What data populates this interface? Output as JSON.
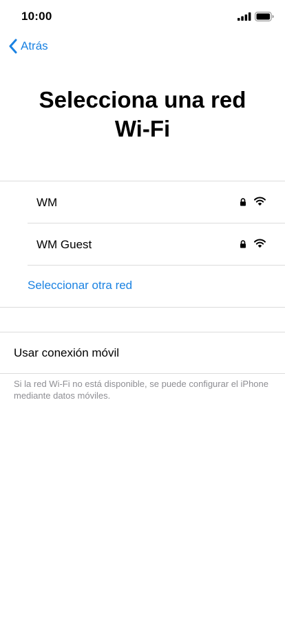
{
  "status_bar": {
    "time": "10:00"
  },
  "nav": {
    "back_label": "Atrás"
  },
  "title": {
    "line1": "Selecciona una red",
    "line2": "Wi-Fi"
  },
  "networks": [
    {
      "name": "WM",
      "secured": true,
      "icon": "wifi-icon"
    },
    {
      "name": "WM Guest",
      "secured": true,
      "icon": "wifi-icon"
    }
  ],
  "other_network_label": "Seleccionar otra red",
  "cellular": {
    "label": "Usar conexión móvil",
    "footnote": "Si la red Wi-Fi no está disponible, se puede configurar el iPhone mediante datos móviles."
  },
  "colors": {
    "accent": "#1a82e2",
    "separator": "#dcdcdc",
    "secondary_text": "#8e8e93"
  }
}
